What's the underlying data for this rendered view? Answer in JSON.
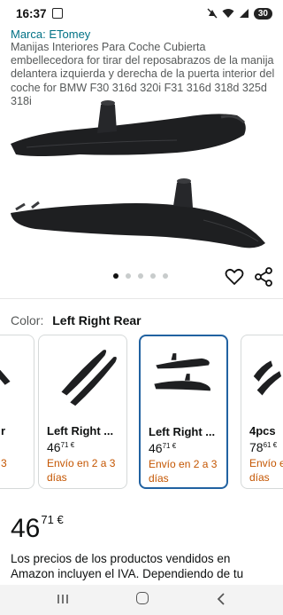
{
  "status_bar": {
    "time": "16:37",
    "battery": "30"
  },
  "product": {
    "brand": "Marca: ETomey",
    "title": "Manijas Interiores Para Coche Cubierta embellecedora for tirar del reposabrazos de la manija delantera izquierda y derecha de la puerta interior del coche for BMW F30 316d 320i F31 316d 318d 325d 318i"
  },
  "carousel": {
    "dot_count": 5,
    "active_index": 0
  },
  "color": {
    "label": "Color:",
    "value": "Left Right Rear"
  },
  "variants": [
    {
      "name": "r",
      "price_whole": "",
      "price_cents": "",
      "ship_line1": "3",
      "ship_line2": ""
    },
    {
      "name": "Left Right ...",
      "price_whole": "46",
      "price_cents": "71 €",
      "ship_line1": "Envío en 2 a 3",
      "ship_line2": "días"
    },
    {
      "name": "Left Right ...",
      "price_whole": "46",
      "price_cents": "71 €",
      "ship_line1": "Envío en 2 a 3",
      "ship_line2": "días"
    },
    {
      "name": "4pcs",
      "price_whole": "78",
      "price_cents": "61 €",
      "ship_line1": "Envío e",
      "ship_line2": "días"
    }
  ],
  "price": {
    "whole": "46",
    "cents": "71 €"
  },
  "tax_note": "Los precios de los productos vendidos en Amazon incluyen el IVA. Dependiendo de tu",
  "colors": {
    "link": "#007185",
    "shipping": "#c45500",
    "selected_border": "#2162a1"
  }
}
